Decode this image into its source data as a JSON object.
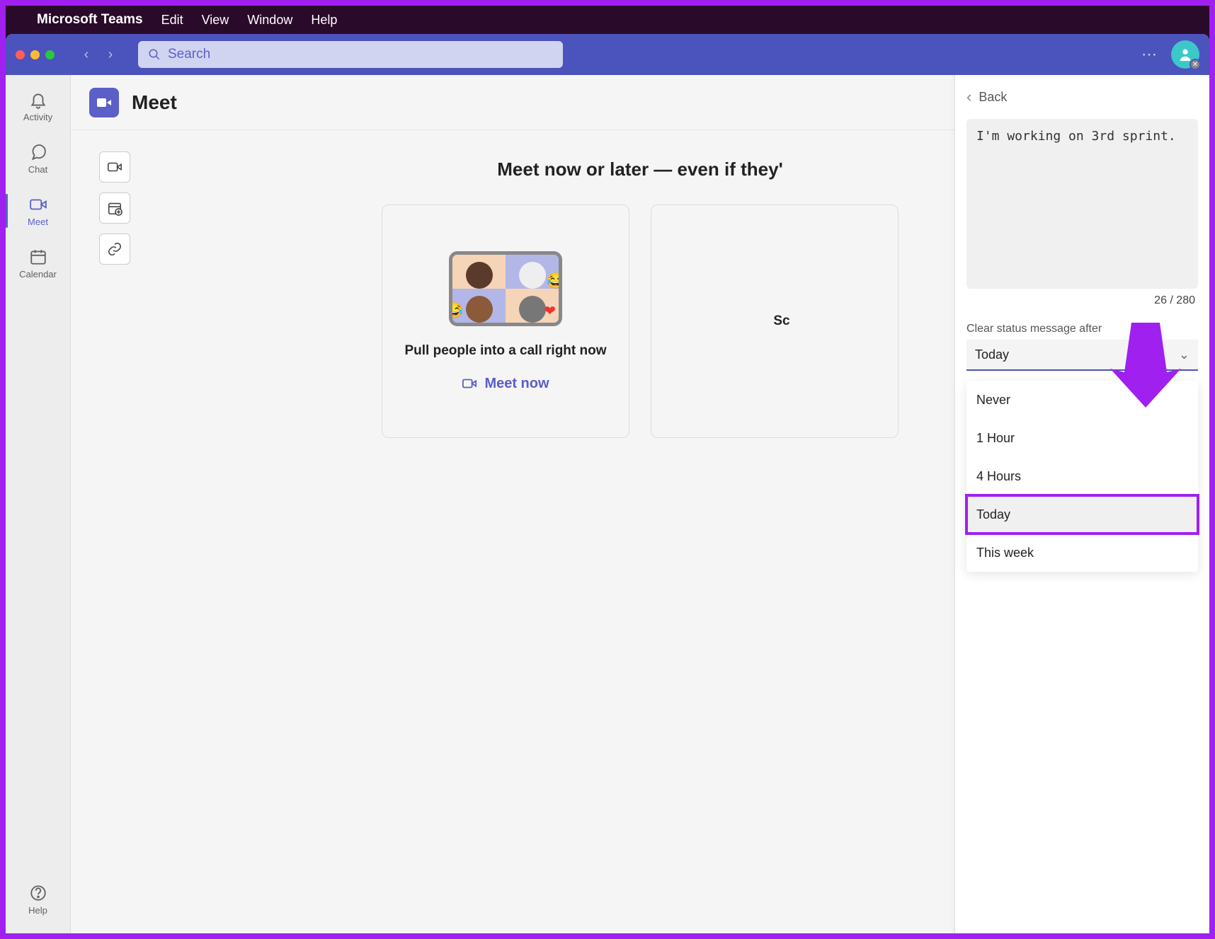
{
  "menubar": {
    "appname": "Microsoft Teams",
    "items": [
      "Edit",
      "View",
      "Window",
      "Help"
    ]
  },
  "titlebar": {
    "search_placeholder": "Search"
  },
  "rail": {
    "items": [
      {
        "label": "Activity"
      },
      {
        "label": "Chat"
      },
      {
        "label": "Meet"
      },
      {
        "label": "Calendar"
      }
    ],
    "help_label": "Help"
  },
  "main": {
    "title": "Meet",
    "hero": "Meet now or later — even if they'",
    "card1": {
      "caption": "Pull people into a call right now",
      "action": "Meet now"
    },
    "card2": {
      "caption": "Sc"
    }
  },
  "panel": {
    "back_label": "Back",
    "status_value": "I'm working on 3rd sprint.",
    "char_count": "26 / 280",
    "clear_label": "Clear status message after",
    "selected": "Today",
    "options": [
      "Never",
      "1 Hour",
      "4 Hours",
      "Today",
      "This week"
    ],
    "highlighted_index": 3
  },
  "colors": {
    "accent": "#5b5fc7",
    "annotation": "#a020f0"
  }
}
